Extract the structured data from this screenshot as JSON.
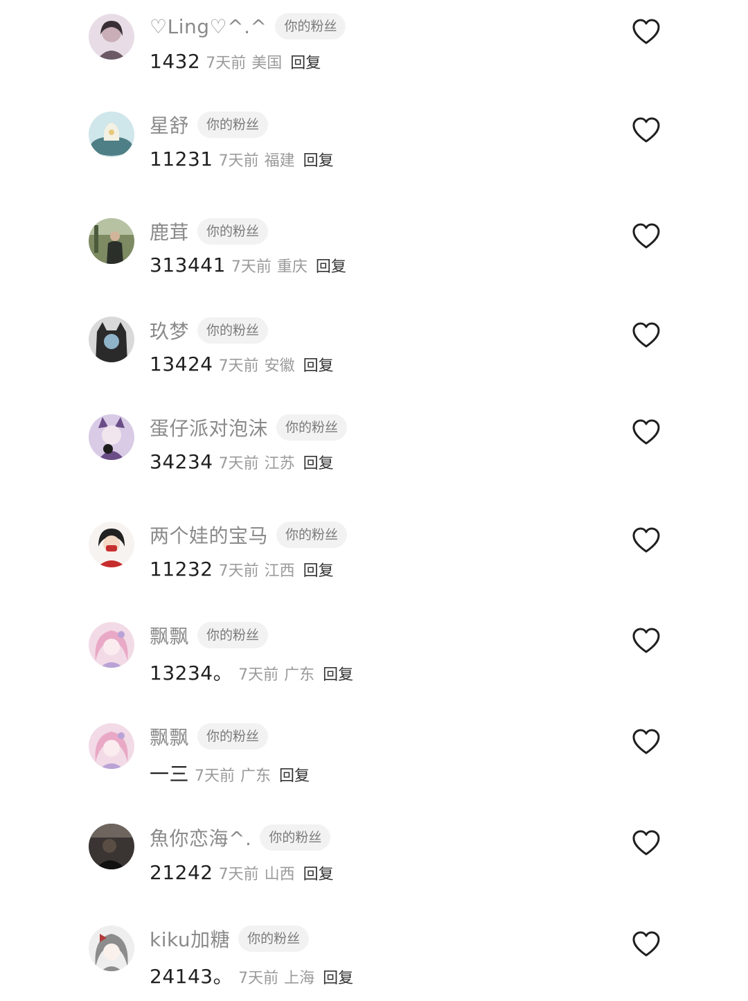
{
  "fan_badge_label": "你的粉丝",
  "reply_label": "回复",
  "comments": [
    {
      "username": "♡Ling♡^.^",
      "text": "1432",
      "time": "7天前",
      "location": "美国",
      "avatar_icon": "avatar-girl-photo",
      "avatar_colors": [
        "#e8dde6",
        "#6b5a66"
      ]
    },
    {
      "username": "星舒",
      "text": "11231",
      "time": "7天前",
      "location": "福建",
      "avatar_icon": "avatar-cloud-scene",
      "avatar_colors": [
        "#cfe6ea",
        "#4f7f86"
      ]
    },
    {
      "username": "鹿茸",
      "text": "313441",
      "time": "7天前",
      "location": "重庆",
      "avatar_icon": "avatar-outdoor-person",
      "avatar_colors": [
        "#7d8a62",
        "#2b2f2a"
      ]
    },
    {
      "username": "玖梦",
      "text": "13424",
      "time": "7天前",
      "location": "安徽",
      "avatar_icon": "avatar-cat-hood",
      "avatar_colors": [
        "#d9d9d9",
        "#2a2a2a"
      ]
    },
    {
      "username": "蛋仔派对泡沫",
      "text": "34234",
      "time": "7天前",
      "location": "江苏",
      "avatar_icon": "avatar-purple-anime",
      "avatar_colors": [
        "#d9cbe6",
        "#6a4c86"
      ]
    },
    {
      "username": "两个娃的宝马",
      "text": "11232",
      "time": "7天前",
      "location": "江西",
      "avatar_icon": "avatar-red-cartoon",
      "avatar_colors": [
        "#f7f3f0",
        "#c62d2d"
      ]
    },
    {
      "username": "飘飘",
      "text": "13234。",
      "time": "7天前",
      "location": "广东",
      "avatar_icon": "avatar-pink-anime",
      "avatar_colors": [
        "#f2dbe6",
        "#b9a3d6"
      ]
    },
    {
      "username": "飘飘",
      "text": "一三",
      "time": "7天前",
      "location": "广东",
      "avatar_icon": "avatar-pink-anime",
      "avatar_colors": [
        "#f2dbe6",
        "#b9a3d6"
      ]
    },
    {
      "username": "魚你恋海^.",
      "text": "21242",
      "time": "7天前",
      "location": "山西",
      "avatar_icon": "avatar-dark-photo",
      "avatar_colors": [
        "#3a3533",
        "#111111"
      ]
    },
    {
      "username": "kiku加糖",
      "text": "24143。",
      "time": "7天前",
      "location": "上海",
      "avatar_icon": "avatar-gray-anime",
      "avatar_colors": [
        "#eeeeee",
        "#8c8c8c"
      ]
    }
  ],
  "like_icon": "heart-outline-icon",
  "like_color": "#1f1f1f"
}
